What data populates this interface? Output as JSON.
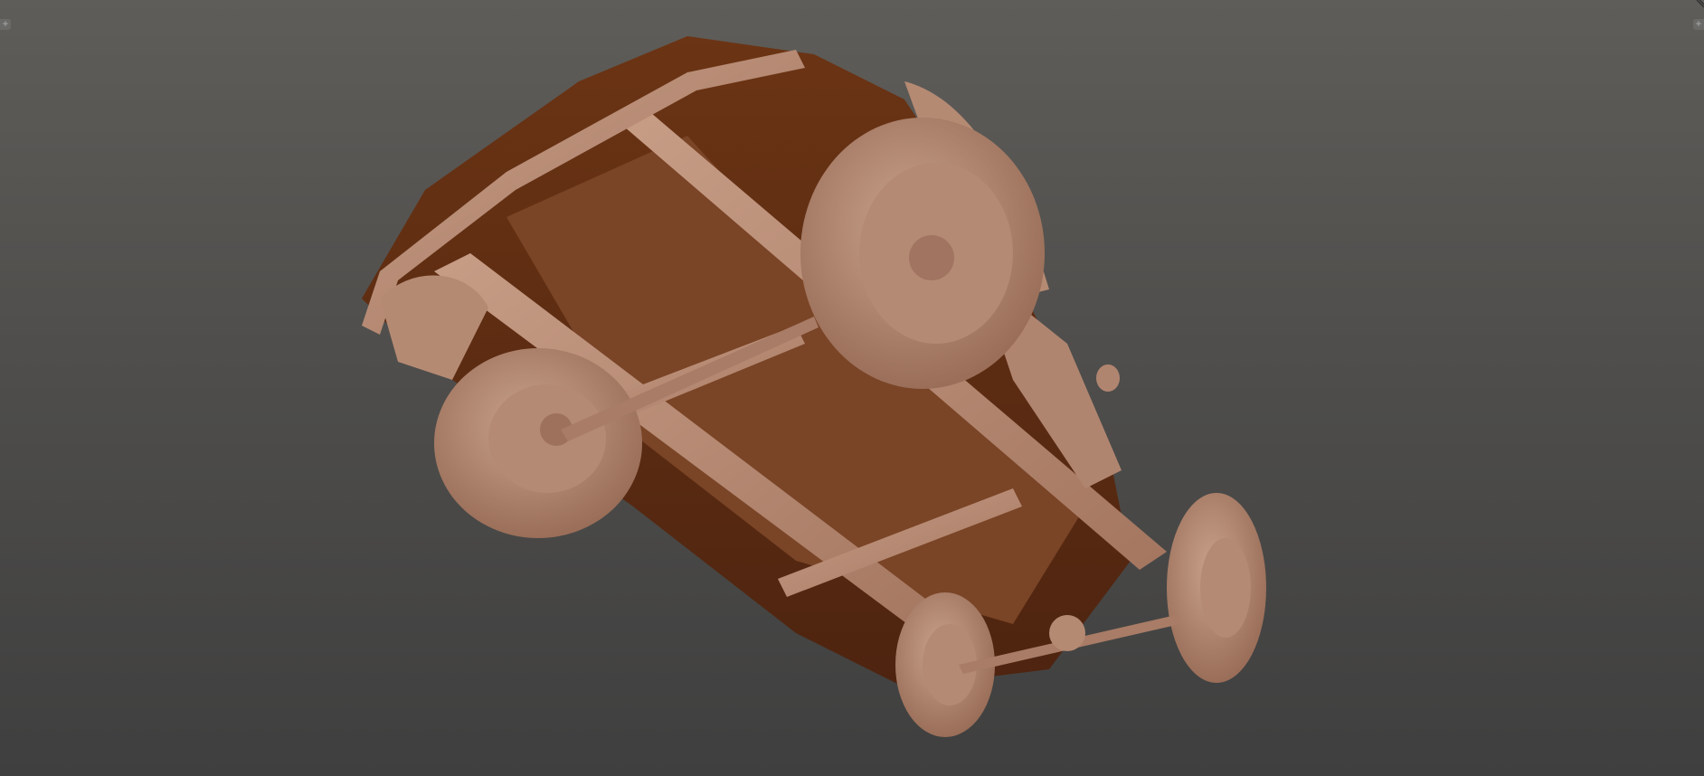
{
  "viewport": {
    "left_button_icon": "plus-icon",
    "right_button_icon": "plus-icon",
    "left_button_glyph": "+",
    "right_button_glyph": "+",
    "model_color": "#b98c74",
    "shadow_color": "#5e2e12",
    "background_top": "#5f5d59",
    "background_bottom": "#3f3f3f"
  }
}
